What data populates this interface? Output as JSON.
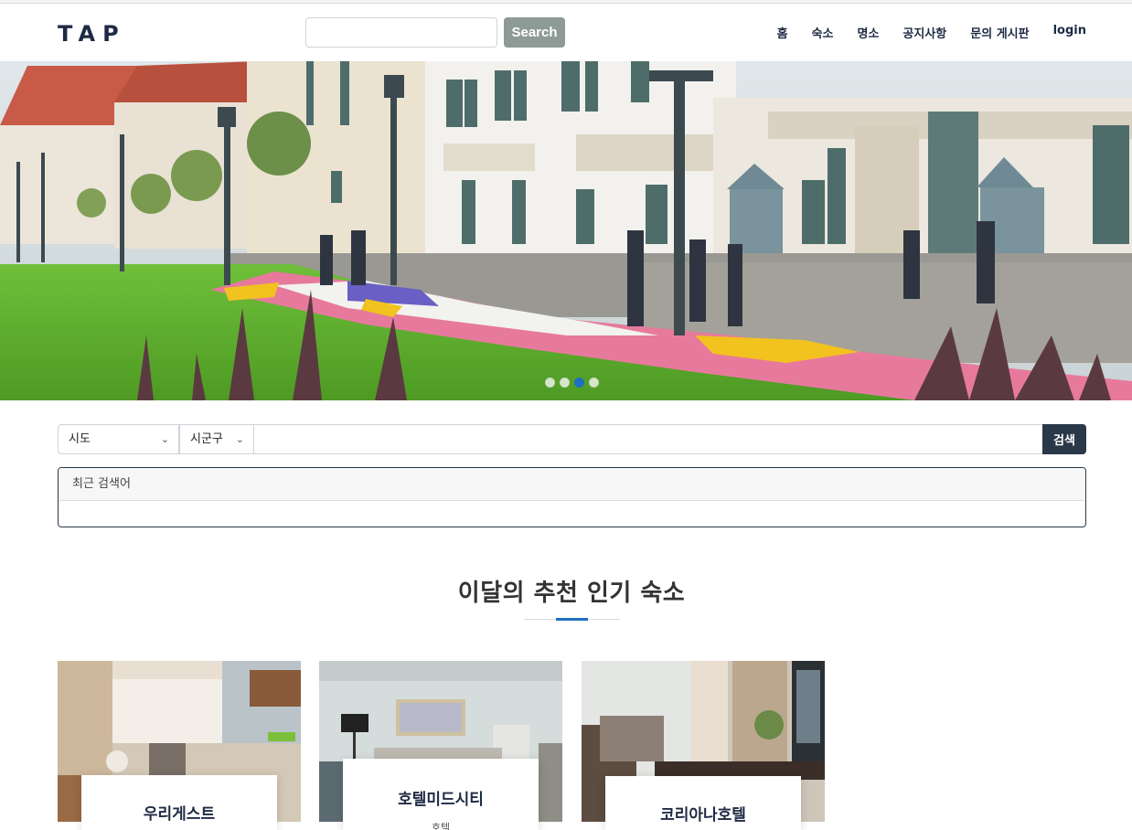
{
  "header": {
    "logo": "TAP",
    "search_button": "Search",
    "nav": [
      "홈",
      "숙소",
      "명소",
      "공지사항",
      "문의 게시판",
      "login"
    ]
  },
  "carousel": {
    "slide_count": 4,
    "active_index": 2
  },
  "search": {
    "sido": "시도",
    "sigungu": "시군구",
    "keyword": "",
    "button": "검색",
    "recent_title": "최근 검색어"
  },
  "section": {
    "title": "이달의 추천 인기 숙소"
  },
  "cards": [
    {
      "name": "우리게스트",
      "type": ""
    },
    {
      "name": "호텔미드시티",
      "type": "호텔"
    },
    {
      "name": "코리아나호텔",
      "type": ""
    }
  ],
  "colors": {
    "brand_dark": "#1e2a44",
    "search_button": "#8d9a96",
    "accent_blue": "#1f6fc0",
    "search_submit": "#2a3848"
  }
}
